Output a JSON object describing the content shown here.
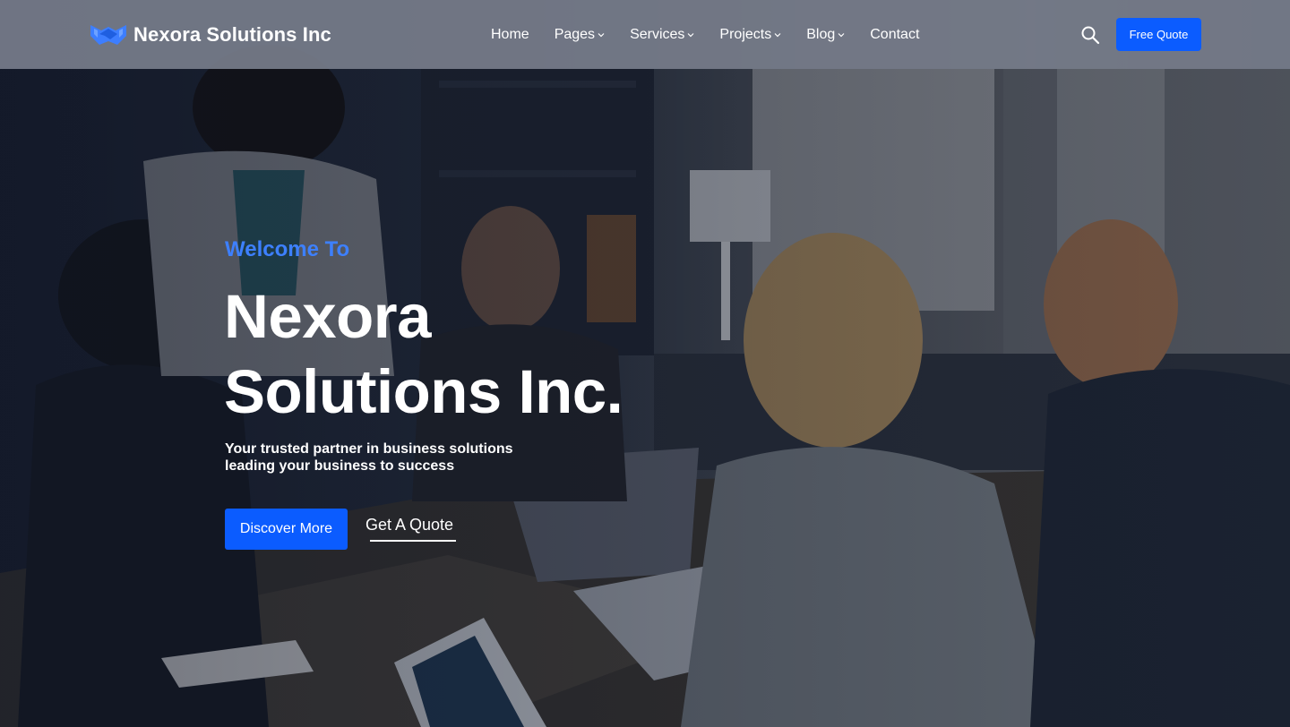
{
  "brand": {
    "name": "Nexora Solutions Inc",
    "logo_icon": "handshake-logo-icon",
    "logo_color": "#3d7eff"
  },
  "nav": {
    "items": [
      {
        "label": "Home",
        "has_dropdown": false
      },
      {
        "label": "Pages",
        "has_dropdown": true
      },
      {
        "label": "Services",
        "has_dropdown": true
      },
      {
        "label": "Projects",
        "has_dropdown": true
      },
      {
        "label": "Blog",
        "has_dropdown": true
      },
      {
        "label": "Contact",
        "has_dropdown": false
      }
    ],
    "search_icon": "search-icon",
    "cta_label": "Free Quote"
  },
  "hero": {
    "eyebrow": "Welcome To",
    "title_line1": "Nexora",
    "title_line2": "Solutions Inc.",
    "tagline": "Your  trusted partner in business solutions\nleading your business to success",
    "primary_button": "Discover More",
    "secondary_link": "Get A Quote",
    "background": "office-meeting-photo"
  },
  "colors": {
    "accent": "#0b5cff",
    "eyebrow": "#3d80ff",
    "navbar_bg": "#767c8a",
    "text": "#ffffff"
  }
}
